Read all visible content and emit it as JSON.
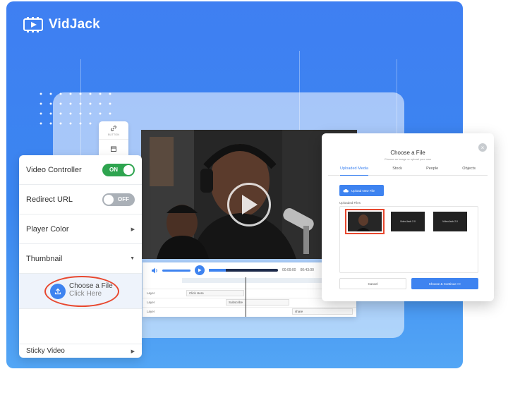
{
  "brand": {
    "name": "VidJack"
  },
  "settings": {
    "video_controller": {
      "label": "Video Controller",
      "toggle": "ON"
    },
    "redirect_url": {
      "label": "Redirect URL",
      "toggle": "OFF"
    },
    "player_color": {
      "label": "Player Color"
    },
    "thumbnail": {
      "label": "Thumbnail",
      "choose": "Choose a File",
      "click": "Click Here"
    },
    "sticky_video": {
      "label": "Sticky Video"
    }
  },
  "toolbar": {
    "button_label": "BUTTON"
  },
  "editor": {
    "time_current": "00:09:00",
    "time_total": "00:43:00",
    "rows": [
      {
        "label": "Layer",
        "clip": "Click Here"
      },
      {
        "label": "Layer",
        "clip": "Subscribe"
      },
      {
        "label": "Layer",
        "clip": "share"
      }
    ]
  },
  "modal": {
    "title": "Choose a File",
    "subtitle": "Choose an image or upload your own",
    "tabs": [
      "Uploaded Media",
      "Stock",
      "People",
      "Objects"
    ],
    "upload_button": "Upload New File",
    "uploaded_label": "Uploaded Files",
    "thumb_caption": "VideoJack 2.0",
    "cancel": "Cancel",
    "continue": "Choose & Continue >>"
  },
  "colors": {
    "accent": "#3e83f0",
    "highlight": "#e8482f",
    "on": "#2ea44f"
  }
}
